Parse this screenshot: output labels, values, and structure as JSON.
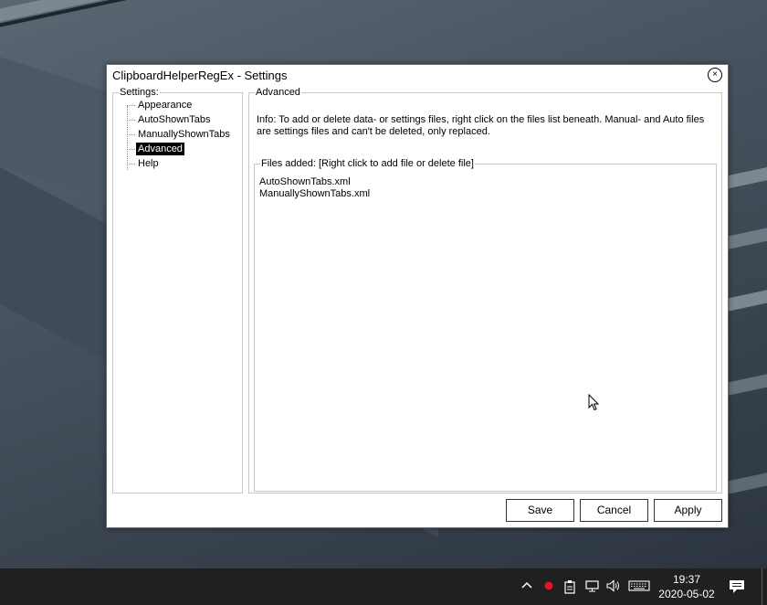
{
  "window": {
    "title": "ClipboardHelperRegEx - Settings",
    "close_symbol": "×"
  },
  "settings_tree": {
    "label": "Settings:",
    "items": [
      {
        "label": "Appearance",
        "selected": false
      },
      {
        "label": "AutoShownTabs",
        "selected": false
      },
      {
        "label": "ManuallyShownTabs",
        "selected": false
      },
      {
        "label": "Advanced",
        "selected": true
      },
      {
        "label": "Help",
        "selected": false
      }
    ]
  },
  "advanced": {
    "label": "Advanced",
    "info": "Info: To add or delete data- or settings files, right click on the files list beneath. Manual- and Auto files are settings files and can't be deleted, only replaced.",
    "files_group_label": "Files added: [Right click to add file or delete file]",
    "files": [
      "AutoShownTabs.xml",
      "ManuallyShownTabs.xml"
    ]
  },
  "buttons": {
    "save": "Save",
    "cancel": "Cancel",
    "apply": "Apply"
  },
  "taskbar": {
    "time": "19:37",
    "date": "2020-05-02",
    "icons": [
      "chevron-up-icon",
      "record-icon",
      "clipboard-icon",
      "network-icon",
      "volume-icon",
      "keyboard-icon",
      "notification-icon"
    ]
  },
  "colors": {
    "selection_bg": "#000000",
    "taskbar_bg": "#202020",
    "record_dot": "#e81123"
  }
}
